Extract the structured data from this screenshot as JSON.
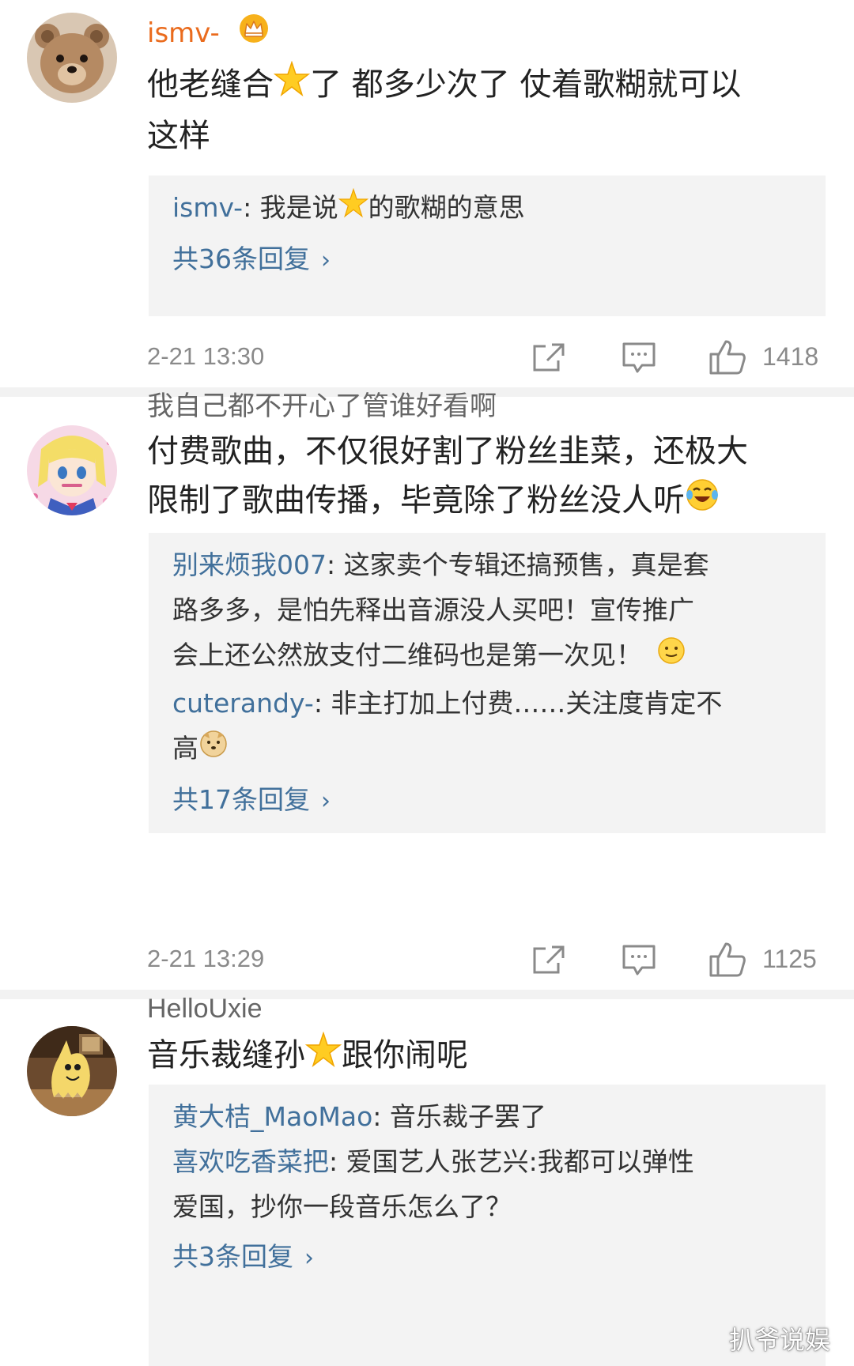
{
  "comments": [
    {
      "username": "ismv-",
      "content_line1_before_star": "他老缝合",
      "content_line1_after_star": "了 都多少次了 仗着歌糊就可以",
      "content_line2": "这样",
      "replies": [
        {
          "user": "ismv-",
          "separator": ": ",
          "text_before_star": "我是说",
          "text_after_star": "的歌糊的意思"
        }
      ],
      "reply_count_label": "共36条回复",
      "timestamp": "2-21 13:30",
      "likes": "1418"
    },
    {
      "username": "我自己都不开心了管谁好看啊",
      "content_line1": "付费歌曲，不仅很好割了粉丝韭菜，还极大",
      "content_line2": "限制了歌曲传播，毕竟除了粉丝没人听",
      "replies": [
        {
          "user": "别来烦我007",
          "separator": ": ",
          "text_line1": "这家卖个专辑还搞预售，真是套",
          "text_line2": "路多多，是怕先释出音源没人买吧！宣传推广",
          "text_line3": "会上还公然放支付二维码也是第一次见！"
        },
        {
          "user": "cuterandy-",
          "separator": ": ",
          "text_line1": "非主打加上付费……关注度肯定不",
          "text_line2": "高"
        }
      ],
      "reply_count_label": "共17条回复",
      "timestamp": "2-21 13:29",
      "likes": "1125"
    },
    {
      "username": "HelloUxie",
      "content_before_star": "音乐裁缝孙",
      "content_after_star": "跟你闹呢",
      "replies": [
        {
          "user": "黄大桔_MaoMao",
          "separator": ": ",
          "text": "音乐裁子罢了"
        },
        {
          "user": "喜欢吃香菜把",
          "separator": ": ",
          "text_line1": "爱国艺人张艺兴:我都可以弹性",
          "text_line2": "爱国，抄你一段音乐怎么了？"
        }
      ],
      "reply_count_label": "共3条回复"
    }
  ],
  "chevron": "›",
  "watermark": "扒爷说娱",
  "colors": {
    "username_vip": "#ea6b1d",
    "username_normal": "#666666",
    "reply_user": "#41709b",
    "meta": "#8a8a8a",
    "reply_bg": "#f3f3f3"
  },
  "icons": [
    "star-emoji",
    "crown-icon",
    "share-icon",
    "comment-icon",
    "like-icon",
    "laugh-cry-emoji",
    "smile-emoji",
    "doge-emoji",
    "chevron-right-icon"
  ]
}
